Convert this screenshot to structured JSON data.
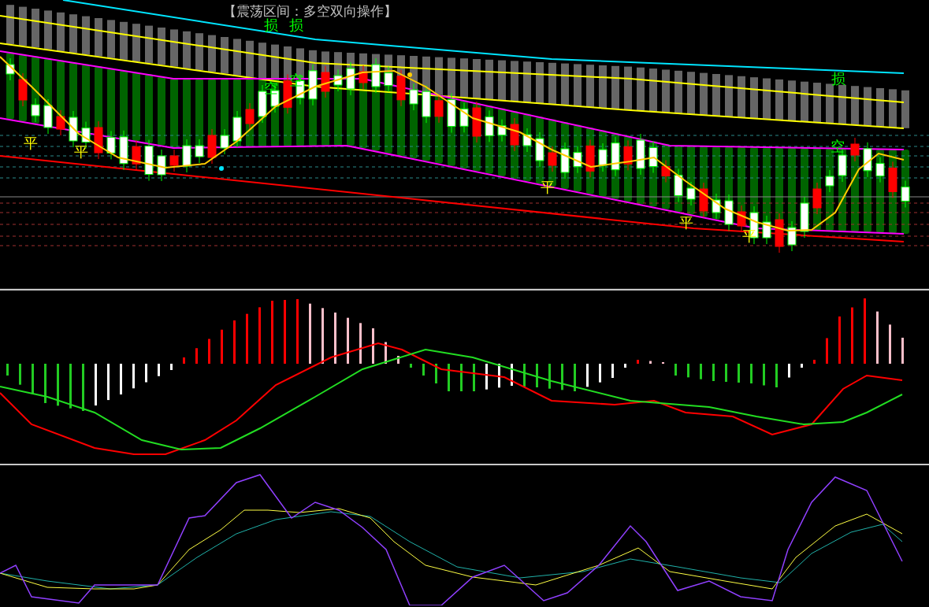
{
  "title": "【震荡区间：多空双向操作】",
  "signals": [
    {
      "kind": "loss",
      "text": "损"
    },
    {
      "kind": "loss",
      "text": "损"
    },
    {
      "kind": "loss",
      "text": "损"
    },
    {
      "kind": "short",
      "text": "空"
    },
    {
      "kind": "short",
      "text": "空"
    },
    {
      "kind": "flat",
      "text": "平"
    },
    {
      "kind": "short",
      "text": "空"
    },
    {
      "kind": "flat",
      "text": "平"
    },
    {
      "kind": "flat",
      "text": "平"
    },
    {
      "kind": "flat",
      "text": "平"
    },
    {
      "kind": "flat",
      "text": "平"
    }
  ]
}
